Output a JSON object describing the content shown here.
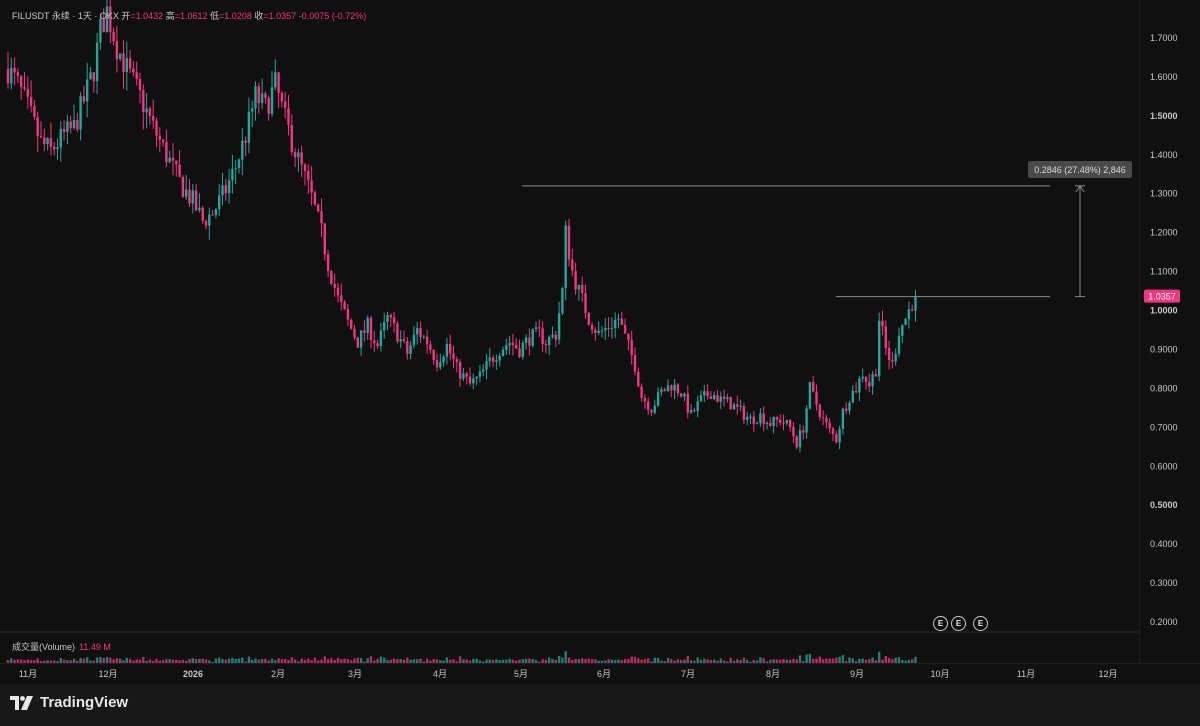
{
  "header": {
    "symbol": "FILUSDT 永续 · 1天 · OKX",
    "open_label": "开",
    "open_value": "=1.0432",
    "high_label": "高",
    "high_value": "=1.0612",
    "low_label": "低",
    "low_value": "=1.0208",
    "close_label": "收",
    "close_value": "=1.0357",
    "change": "-0.0075 (-0.72%)"
  },
  "volume_panel": {
    "label": "成交量(Volume)",
    "value": "11.49 M"
  },
  "measure_label": "0.2846 (27.48%) 2,846",
  "current_price_label": "1.0357",
  "event_badges": [
    "E",
    "E",
    "E"
  ],
  "branding": {
    "name": "TradingView"
  },
  "colors": {
    "up": "#26a69a",
    "down": "#f23680",
    "background": "#101010",
    "text": "#c8c8c8"
  },
  "chart_data": {
    "type": "candlestick",
    "title": "FILUSDT 永续 · 1天 · OKX",
    "y_ticks": [
      "1.7000",
      "1.6000",
      "1.5000",
      "1.4000",
      "1.3000",
      "1.2000",
      "1.1000",
      "1.0000",
      "0.9000",
      "0.8000",
      "0.7000",
      "0.6000",
      "0.5000",
      "0.4000",
      "0.3000",
      "0.2000"
    ],
    "y_range": [
      0.2,
      1.7
    ],
    "x_ticks": [
      "11月",
      "12月",
      "2026",
      "2月",
      "3月",
      "4月",
      "5月",
      "6月",
      "7月",
      "8月",
      "9月",
      "10月",
      "11月",
      "12月"
    ],
    "measurement": {
      "from_price": 1.0357,
      "to_price": 1.3203,
      "change": 0.2846,
      "change_pct": 27.48
    },
    "last_price": 1.0357,
    "series": [
      {
        "name": "FILUSDT",
        "close_path": [
          [
            0,
            1.62
          ],
          [
            3,
            1.58
          ],
          [
            6,
            1.52
          ],
          [
            10,
            1.43
          ],
          [
            13,
            1.41
          ],
          [
            17,
            1.45
          ],
          [
            20,
            1.47
          ],
          [
            23,
            1.54
          ],
          [
            26,
            1.62
          ],
          [
            28,
            1.72
          ],
          [
            30,
            1.77
          ],
          [
            33,
            1.68
          ],
          [
            36,
            1.62
          ],
          [
            40,
            1.55
          ],
          [
            44,
            1.47
          ],
          [
            48,
            1.4
          ],
          [
            52,
            1.33
          ],
          [
            56,
            1.28
          ],
          [
            59,
            1.23
          ],
          [
            62,
            1.25
          ],
          [
            66,
            1.31
          ],
          [
            69,
            1.37
          ],
          [
            72,
            1.45
          ],
          [
            75,
            1.55
          ],
          [
            78,
            1.52
          ],
          [
            81,
            1.58
          ],
          [
            84,
            1.49
          ],
          [
            87,
            1.41
          ],
          [
            90,
            1.34
          ],
          [
            92,
            1.29
          ],
          [
            95,
            1.2
          ],
          [
            97,
            1.12
          ],
          [
            100,
            1.03
          ],
          [
            103,
            0.97
          ],
          [
            106,
            0.92
          ],
          [
            109,
            0.96
          ],
          [
            112,
            0.91
          ],
          [
            115,
            0.98
          ],
          [
            118,
            0.94
          ],
          [
            121,
            0.89
          ],
          [
            124,
            0.95
          ],
          [
            127,
            0.92
          ],
          [
            130,
            0.87
          ],
          [
            133,
            0.91
          ],
          [
            136,
            0.85
          ],
          [
            140,
            0.81
          ],
          [
            143,
            0.83
          ],
          [
            146,
            0.87
          ],
          [
            149,
            0.9
          ],
          [
            152,
            0.92
          ],
          [
            155,
            0.9
          ],
          [
            158,
            0.93
          ],
          [
            161,
            0.94
          ],
          [
            163,
            0.92
          ],
          [
            166,
            0.94
          ],
          [
            168,
            1.05
          ],
          [
            169,
            1.2
          ],
          [
            171,
            1.1
          ],
          [
            173,
            1.05
          ],
          [
            176,
            0.98
          ],
          [
            179,
            0.94
          ],
          [
            182,
            0.96
          ],
          [
            185,
            0.98
          ],
          [
            187,
            0.93
          ],
          [
            190,
            0.86
          ],
          [
            192,
            0.78
          ],
          [
            195,
            0.75
          ],
          [
            198,
            0.79
          ],
          [
            201,
            0.81
          ],
          [
            204,
            0.79
          ],
          [
            207,
            0.73
          ],
          [
            210,
            0.77
          ],
          [
            213,
            0.79
          ],
          [
            216,
            0.77
          ],
          [
            219,
            0.76
          ],
          [
            222,
            0.74
          ],
          [
            225,
            0.72
          ],
          [
            228,
            0.73
          ],
          [
            231,
            0.71
          ],
          [
            234,
            0.72
          ],
          [
            237,
            0.7
          ],
          [
            239,
            0.66
          ],
          [
            241,
            0.7
          ],
          [
            243,
            0.8
          ],
          [
            245,
            0.76
          ],
          [
            247,
            0.72
          ],
          [
            249,
            0.69
          ],
          [
            251,
            0.67
          ],
          [
            253,
            0.74
          ],
          [
            255,
            0.78
          ],
          [
            257,
            0.8
          ],
          [
            259,
            0.84
          ],
          [
            261,
            0.81
          ],
          [
            263,
            0.85
          ],
          [
            264,
            0.98
          ],
          [
            266,
            0.9
          ],
          [
            268,
            0.86
          ],
          [
            270,
            0.95
          ],
          [
            272,
            0.98
          ],
          [
            274,
            1.02
          ],
          [
            275,
            1.0357
          ]
        ]
      }
    ],
    "volume": {
      "label": "成交量(Volume)",
      "last": "11.49 M"
    }
  }
}
